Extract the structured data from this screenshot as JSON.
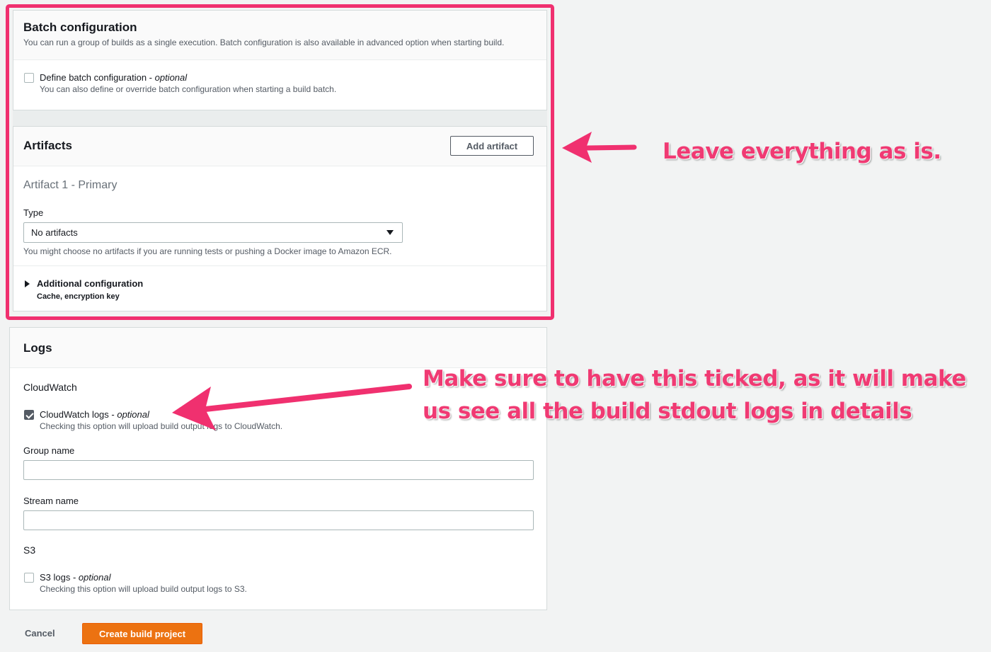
{
  "batch": {
    "title": "Batch configuration",
    "description": "You can run a group of builds as a single execution. Batch configuration is also available in advanced option when starting build.",
    "define_label": "Define batch configuration - ",
    "define_optional": "optional",
    "define_desc": "You can also define or override batch configuration when starting a build batch.",
    "define_checked": false
  },
  "artifacts": {
    "title": "Artifacts",
    "add_button": "Add artifact",
    "artifact_heading": "Artifact 1 - Primary",
    "type_label": "Type",
    "type_value": "No artifacts",
    "type_hint": "You might choose no artifacts if you are running tests or pushing a Docker image to Amazon ECR.",
    "additional_title": "Additional configuration",
    "additional_desc": "Cache, encryption key"
  },
  "logs": {
    "title": "Logs",
    "cloudwatch_heading": "CloudWatch",
    "cloudwatch_label": "CloudWatch logs - ",
    "cloudwatch_optional": "optional",
    "cloudwatch_desc": "Checking this option will upload build output logs to CloudWatch.",
    "cloudwatch_checked": true,
    "group_name_label": "Group name",
    "group_name_value": "",
    "stream_name_label": "Stream name",
    "stream_name_value": "",
    "s3_heading": "S3",
    "s3_label": "S3 logs - ",
    "s3_optional": "optional",
    "s3_desc": "Checking this option will upload build output logs to S3.",
    "s3_checked": false
  },
  "footer": {
    "cancel": "Cancel",
    "create": "Create build project"
  },
  "annotations": {
    "leave": "Leave everything as is.",
    "ticked_line1": "Make sure to have this ticked, as it will make",
    "ticked_line2": "us see all the build stdout logs in details",
    "color": "#f03a73"
  },
  "colors": {
    "highlight_border": "#f0306f",
    "primary_button": "#ec7211"
  }
}
